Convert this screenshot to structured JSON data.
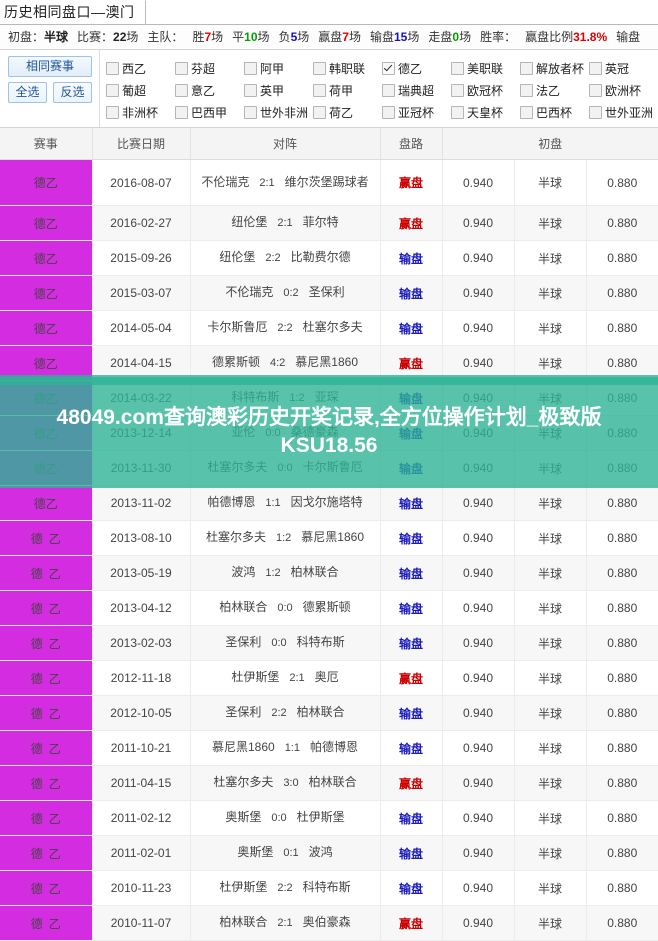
{
  "window": {
    "tab_title": "历史相同盘口—澳门"
  },
  "stats": {
    "items": [
      {
        "label": "初盘：",
        "value": "半球",
        "color": "dark"
      },
      {
        "label": "比赛：",
        "value": "22",
        "unit": "场",
        "color": "dark"
      },
      {
        "label": "主队：",
        "value": "",
        "unit": "",
        "color": "dark"
      },
      {
        "label": "胜",
        "value": "7",
        "unit": "场",
        "color": "red"
      },
      {
        "label": "平",
        "value": "10",
        "unit": "场",
        "color": "green"
      },
      {
        "label": "负",
        "value": "5",
        "unit": "场",
        "color": "blue"
      },
      {
        "label": "赢盘",
        "value": "7",
        "unit": "场",
        "color": "red"
      },
      {
        "label": "输盘",
        "value": "15",
        "unit": "场",
        "color": "blue"
      },
      {
        "label": "走盘",
        "value": "0",
        "unit": "场",
        "color": "green"
      },
      {
        "label": "胜率：",
        "value": "",
        "unit": "",
        "color": "dark"
      },
      {
        "label": "赢盘比例",
        "value": "31.8%",
        "unit": "",
        "color": "red"
      },
      {
        "label": "输盘",
        "value": "",
        "unit": "",
        "color": "dark"
      }
    ]
  },
  "filters": {
    "same_league_button": "相同赛事",
    "select_all_button": "全选",
    "invert_button": "反选",
    "leagues": [
      {
        "label": "西乙",
        "checked": false
      },
      {
        "label": "芬超",
        "checked": false
      },
      {
        "label": "阿甲",
        "checked": false
      },
      {
        "label": "韩职联",
        "checked": false
      },
      {
        "label": "德乙",
        "checked": true
      },
      {
        "label": "美职联",
        "checked": false
      },
      {
        "label": "解放者杯",
        "checked": false
      },
      {
        "label": "英冠",
        "checked": false
      },
      {
        "label": "葡超",
        "checked": false
      },
      {
        "label": "意乙",
        "checked": false
      },
      {
        "label": "英甲",
        "checked": false
      },
      {
        "label": "荷甲",
        "checked": false
      },
      {
        "label": "瑞典超",
        "checked": false
      },
      {
        "label": "欧冠杯",
        "checked": false
      },
      {
        "label": "法乙",
        "checked": false
      },
      {
        "label": "欧洲杯",
        "checked": false
      },
      {
        "label": "非洲杯",
        "checked": false
      },
      {
        "label": "巴西甲",
        "checked": false
      },
      {
        "label": "世外非洲",
        "checked": false
      },
      {
        "label": "荷乙",
        "checked": false
      },
      {
        "label": "亚冠杯",
        "checked": false
      },
      {
        "label": "天皇杯",
        "checked": false
      },
      {
        "label": "巴西杯",
        "checked": false
      },
      {
        "label": "世外亚洲",
        "checked": false
      }
    ]
  },
  "table": {
    "headers": [
      "赛事",
      "比赛日期",
      "对阵",
      "盘路",
      "初盘"
    ],
    "rows": [
      {
        "league": "德乙",
        "spaced": false,
        "date": "2016-08-07",
        "home": "不伦瑞克",
        "score": "2:1",
        "away": "维尔茨堡踢球者",
        "result": "赢盘",
        "result_type": "win",
        "odds_home": "0.940",
        "handicap": "半球",
        "odds_away": "0.880"
      },
      {
        "league": "德乙",
        "spaced": false,
        "date": "2016-02-27",
        "home": "纽伦堡",
        "score": "2:1",
        "away": "菲尔特",
        "result": "赢盘",
        "result_type": "win",
        "odds_home": "0.940",
        "handicap": "半球",
        "odds_away": "0.880"
      },
      {
        "league": "德乙",
        "spaced": false,
        "date": "2015-09-26",
        "home": "纽伦堡",
        "score": "2:2",
        "away": "比勒费尔德",
        "result": "输盘",
        "result_type": "lose",
        "odds_home": "0.940",
        "handicap": "半球",
        "odds_away": "0.880"
      },
      {
        "league": "德乙",
        "spaced": false,
        "date": "2015-03-07",
        "home": "不伦瑞克",
        "score": "0:2",
        "away": "圣保利",
        "result": "输盘",
        "result_type": "lose",
        "odds_home": "0.940",
        "handicap": "半球",
        "odds_away": "0.880"
      },
      {
        "league": "德乙",
        "spaced": false,
        "date": "2014-05-04",
        "home": "卡尔斯鲁厄",
        "score": "2:2",
        "away": "杜塞尔多夫",
        "result": "输盘",
        "result_type": "lose",
        "odds_home": "0.940",
        "handicap": "半球",
        "odds_away": "0.880"
      },
      {
        "league": "德乙",
        "spaced": false,
        "date": "2014-04-15",
        "home": "德累斯顿",
        "score": "4:2",
        "away": "慕尼黑1860",
        "result": "赢盘",
        "result_type": "win",
        "odds_home": "0.940",
        "handicap": "半球",
        "odds_away": "0.880"
      },
      {
        "league": "德乙",
        "spaced": false,
        "date": "2014-03-22",
        "home": "科特布斯",
        "score": "1:2",
        "away": "亚琛",
        "result": "输盘",
        "result_type": "lose",
        "odds_home": "0.940",
        "handicap": "半球",
        "odds_away": "0.880"
      },
      {
        "league": "德乙",
        "spaced": false,
        "date": "2013-12-14",
        "home": "亚伦",
        "score": "0:0",
        "away": "桑德豪森",
        "result": "输盘",
        "result_type": "lose",
        "odds_home": "0.940",
        "handicap": "半球",
        "odds_away": "0.880"
      },
      {
        "league": "德乙",
        "spaced": false,
        "date": "2013-11-30",
        "home": "杜塞尔多夫",
        "score": "0:0",
        "away": "卡尔斯鲁厄",
        "result": "输盘",
        "result_type": "lose",
        "odds_home": "0.940",
        "handicap": "半球",
        "odds_away": "0.880"
      },
      {
        "league": "德乙",
        "spaced": false,
        "date": "2013-11-02",
        "home": "帕德博恩",
        "score": "1:1",
        "away": "因戈尔施塔特",
        "result": "输盘",
        "result_type": "lose",
        "odds_home": "0.940",
        "handicap": "半球",
        "odds_away": "0.880"
      },
      {
        "league": "德乙",
        "spaced": true,
        "date": "2013-08-10",
        "home": "杜塞尔多夫",
        "score": "1:2",
        "away": "慕尼黑1860",
        "result": "输盘",
        "result_type": "lose",
        "odds_home": "0.940",
        "handicap": "半球",
        "odds_away": "0.880"
      },
      {
        "league": "德乙",
        "spaced": true,
        "date": "2013-05-19",
        "home": "波鸿",
        "score": "1:2",
        "away": "柏林联合",
        "result": "输盘",
        "result_type": "lose",
        "odds_home": "0.940",
        "handicap": "半球",
        "odds_away": "0.880"
      },
      {
        "league": "德乙",
        "spaced": true,
        "date": "2013-04-12",
        "home": "柏林联合",
        "score": "0:0",
        "away": "德累斯顿",
        "result": "输盘",
        "result_type": "lose",
        "odds_home": "0.940",
        "handicap": "半球",
        "odds_away": "0.880"
      },
      {
        "league": "德乙",
        "spaced": true,
        "date": "2013-02-03",
        "home": "圣保利",
        "score": "0:0",
        "away": "科特布斯",
        "result": "输盘",
        "result_type": "lose",
        "odds_home": "0.940",
        "handicap": "半球",
        "odds_away": "0.880"
      },
      {
        "league": "德乙",
        "spaced": true,
        "date": "2012-11-18",
        "home": "杜伊斯堡",
        "score": "2:1",
        "away": "奥厄",
        "result": "赢盘",
        "result_type": "win",
        "odds_home": "0.940",
        "handicap": "半球",
        "odds_away": "0.880"
      },
      {
        "league": "德乙",
        "spaced": true,
        "date": "2012-10-05",
        "home": "圣保利",
        "score": "2:2",
        "away": "柏林联合",
        "result": "输盘",
        "result_type": "lose",
        "odds_home": "0.940",
        "handicap": "半球",
        "odds_away": "0.880"
      },
      {
        "league": "德乙",
        "spaced": true,
        "date": "2011-10-21",
        "home": "慕尼黑1860",
        "score": "1:1",
        "away": "帕德博恩",
        "result": "输盘",
        "result_type": "lose",
        "odds_home": "0.940",
        "handicap": "半球",
        "odds_away": "0.880"
      },
      {
        "league": "德乙",
        "spaced": true,
        "date": "2011-04-15",
        "home": "杜塞尔多夫",
        "score": "3:0",
        "away": "柏林联合",
        "result": "赢盘",
        "result_type": "win",
        "odds_home": "0.940",
        "handicap": "半球",
        "odds_away": "0.880"
      },
      {
        "league": "德乙",
        "spaced": true,
        "date": "2011-02-12",
        "home": "奥斯堡",
        "score": "0:0",
        "away": "杜伊斯堡",
        "result": "输盘",
        "result_type": "lose",
        "odds_home": "0.940",
        "handicap": "半球",
        "odds_away": "0.880"
      },
      {
        "league": "德乙",
        "spaced": true,
        "date": "2011-02-01",
        "home": "奥斯堡",
        "score": "0:1",
        "away": "波鸿",
        "result": "输盘",
        "result_type": "lose",
        "odds_home": "0.940",
        "handicap": "半球",
        "odds_away": "0.880"
      },
      {
        "league": "德乙",
        "spaced": true,
        "date": "2010-11-23",
        "home": "杜伊斯堡",
        "score": "2:2",
        "away": "科特布斯",
        "result": "输盘",
        "result_type": "lose",
        "odds_home": "0.940",
        "handicap": "半球",
        "odds_away": "0.880"
      },
      {
        "league": "德乙",
        "spaced": true,
        "date": "2010-11-07",
        "home": "柏林联合",
        "score": "2:1",
        "away": "奥伯豪森",
        "result": "赢盘",
        "result_type": "win",
        "odds_home": "0.940",
        "handicap": "半球",
        "odds_away": "0.880"
      }
    ]
  },
  "overlay": {
    "text": "48049.com查询澳彩历史开奖记录,全方位操作计划_极致版KSU18.56",
    "color": "#2eb396"
  }
}
